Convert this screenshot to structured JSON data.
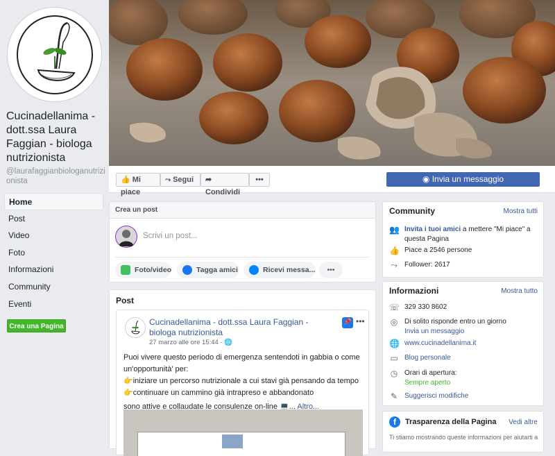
{
  "sidebar": {
    "page_name": "Cucinadellanima - dott.ssa Laura Faggian - biologa nutrizionista",
    "handle": "@laurafaggianbiologanutrizionista",
    "nav": [
      "Home",
      "Post",
      "Video",
      "Foto",
      "Informazioni",
      "Community",
      "Eventi"
    ],
    "create_page": "Crea una Pagina"
  },
  "actions": {
    "like": "Mi piace",
    "follow": "Segui",
    "share": "Condividi",
    "more": "•••",
    "message": "Invia un messaggio"
  },
  "create_post": {
    "header": "Crea un post",
    "placeholder": "Scrivi un post...",
    "photo": "Foto/video",
    "tag": "Tagga amici",
    "receive": "Ricevi messa...",
    "more": "•••"
  },
  "post_section": {
    "title": "Post",
    "author": "Cucinadellanima - dott.ssa Laura Faggian - biologa nutrizionista",
    "date": "27 marzo alle ore 15:44 · ",
    "more": "•••",
    "text_1": "Puoi vivere questo periodo di emergenza sentendoti in gabbia o come un'opportunità' per:",
    "text_2": "👉iniziare un percorso nutrizionale a cui stavi già pensando da tempo",
    "text_3": "👉continuare un cammino già intrapreso e abbandonato",
    "text_4": "sono attive e collaudate le consulenze on-line 💻...",
    "read_more": "Altro..."
  },
  "community": {
    "title": "Community",
    "see_all": "Mostra tutti",
    "invite_link": "Invita i tuoi amici",
    "invite_rest": " a mettere \"Mi piace\" a questa Pagina",
    "likes": "Piace a 2546 persone",
    "followers": "Follower: 2617"
  },
  "info": {
    "title": "Informazioni",
    "see_all": "Mostra tutto",
    "phone": "329 330 8602",
    "response": "Di solito risponde entro un giorno",
    "send_message": "Invia un messaggio",
    "website": "www.cucinadellanima.it",
    "blog": "Blog personale",
    "hours_label": "Orari di apertura:",
    "hours_status": "Sempre aperto",
    "suggest": "Suggerisci modifiche"
  },
  "transparency": {
    "title": "Trasparenza della Pagina",
    "see_all": "Vedi altre",
    "text": "Ti stiamo mostrando queste informazioni per aiutarti a"
  },
  "colors": {
    "brand": "#4267b2",
    "green": "#42b72a",
    "link": "#385898"
  }
}
